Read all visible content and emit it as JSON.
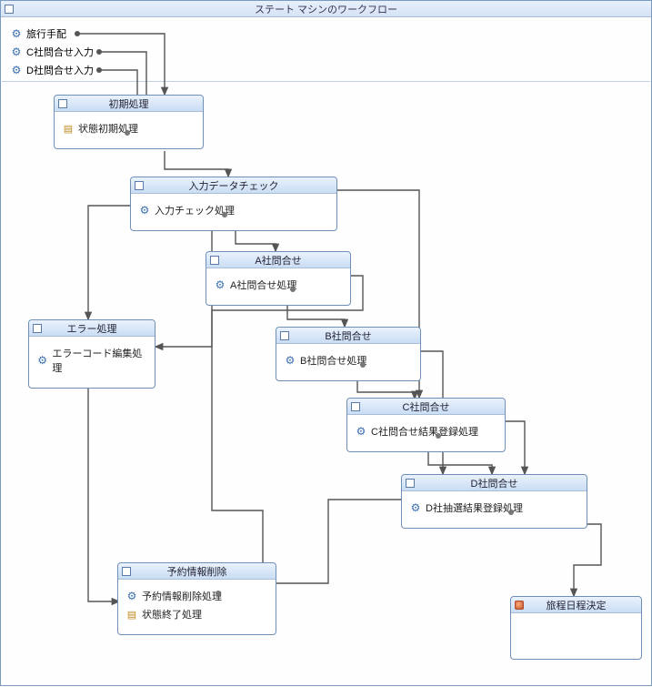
{
  "title": "ステート マシンのワークフロー",
  "inputs": {
    "travel": "旅行手配",
    "c_input": "C社問合せ入力",
    "d_input": "D社問合せ入力"
  },
  "states": {
    "init": {
      "title": "初期処理",
      "act1": "状態初期処理"
    },
    "validate": {
      "title": "入力データチェック",
      "act1": "入力チェック処理"
    },
    "a": {
      "title": "A社問合せ",
      "act1": "A社問合せ処理"
    },
    "error": {
      "title": "エラー処理",
      "act1": "エラーコード編集処理"
    },
    "b": {
      "title": "B社問合せ",
      "act1": "B社問合せ処理"
    },
    "c": {
      "title": "C社問合せ",
      "act1": "C社問合せ結果登録処理"
    },
    "d": {
      "title": "D社問合せ",
      "act1": "D社抽選結果登録処理"
    },
    "delete": {
      "title": "予約情報削除",
      "act1": "予約情報削除処理",
      "act2": "状態終了処理"
    },
    "final": {
      "title": "旅程日程決定"
    }
  }
}
